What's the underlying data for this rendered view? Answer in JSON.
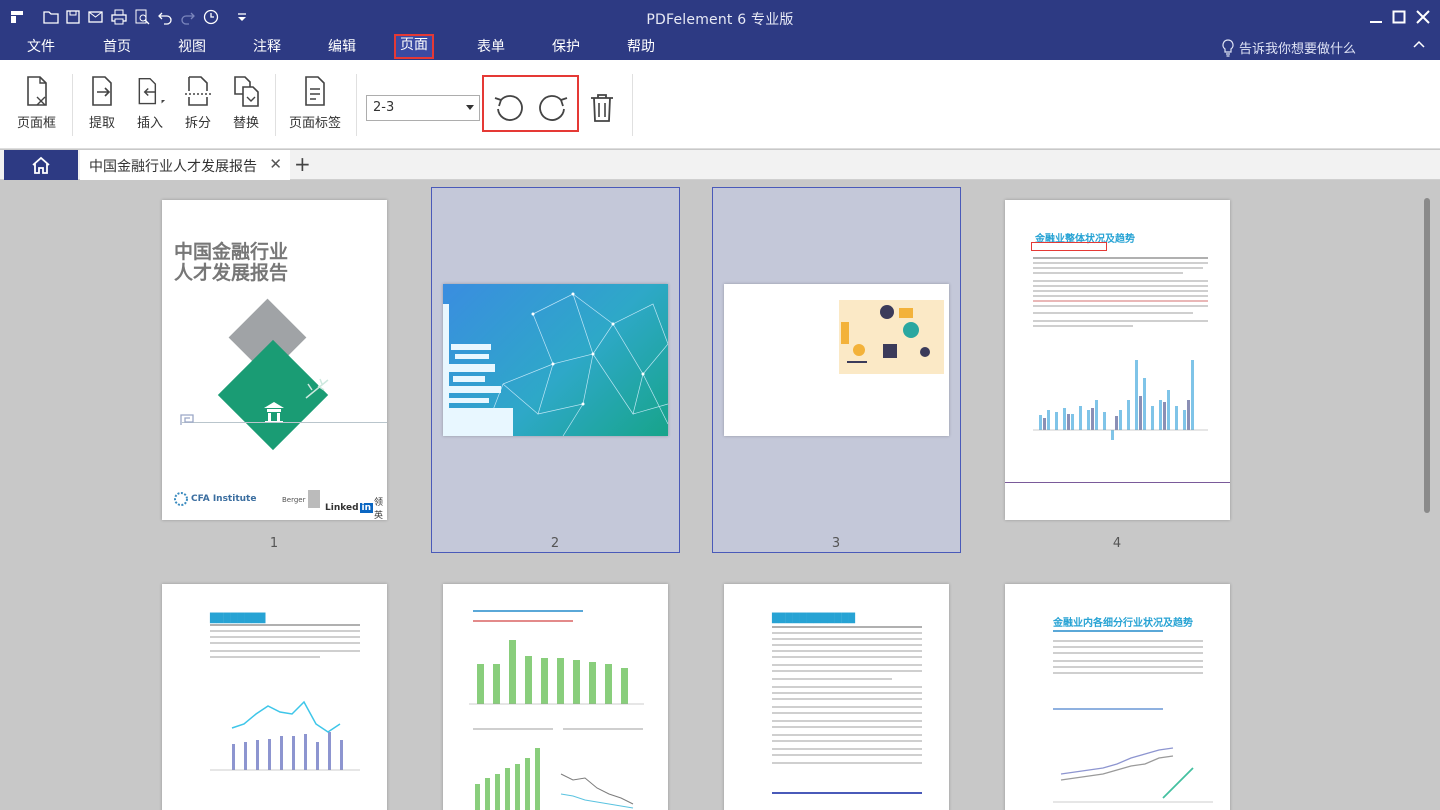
{
  "app": {
    "title": "PDFelement  6 专业版"
  },
  "menu": {
    "file": "文件",
    "home": "首页",
    "view": "视图",
    "comment": "注释",
    "edit": "编辑",
    "page": "页面",
    "form": "表单",
    "protect": "保护",
    "help": "帮助",
    "tell_me": "告诉我你想要做什么"
  },
  "ribbon": {
    "page_box": "页面框",
    "extract": "提取",
    "insert": "插入",
    "split": "拆分",
    "replace": "替换",
    "page_label": "页面标签",
    "page_range": "2-3"
  },
  "tabs": {
    "document": "中国金融行业人才发展报告"
  },
  "thumbs": {
    "p1": "1",
    "p2": "2",
    "p3": "3",
    "p4": "4",
    "cover_title_1": "中国金融行业",
    "cover_title_2": "人才发展报告",
    "cfa": "CFA Institute",
    "berger": "Berger",
    "linkedin": "Linked",
    "linkedin_in": "in",
    "linkedin_cn": "领英",
    "p4_title": "金融业整体状况及趋势",
    "p8_title": "金融业内各细分行业状况及趋势"
  },
  "colors": {
    "brand": "#2d3a83",
    "highlight": "#e53935",
    "accent": "#27a3d4",
    "cover_green": "#1a9c74"
  }
}
